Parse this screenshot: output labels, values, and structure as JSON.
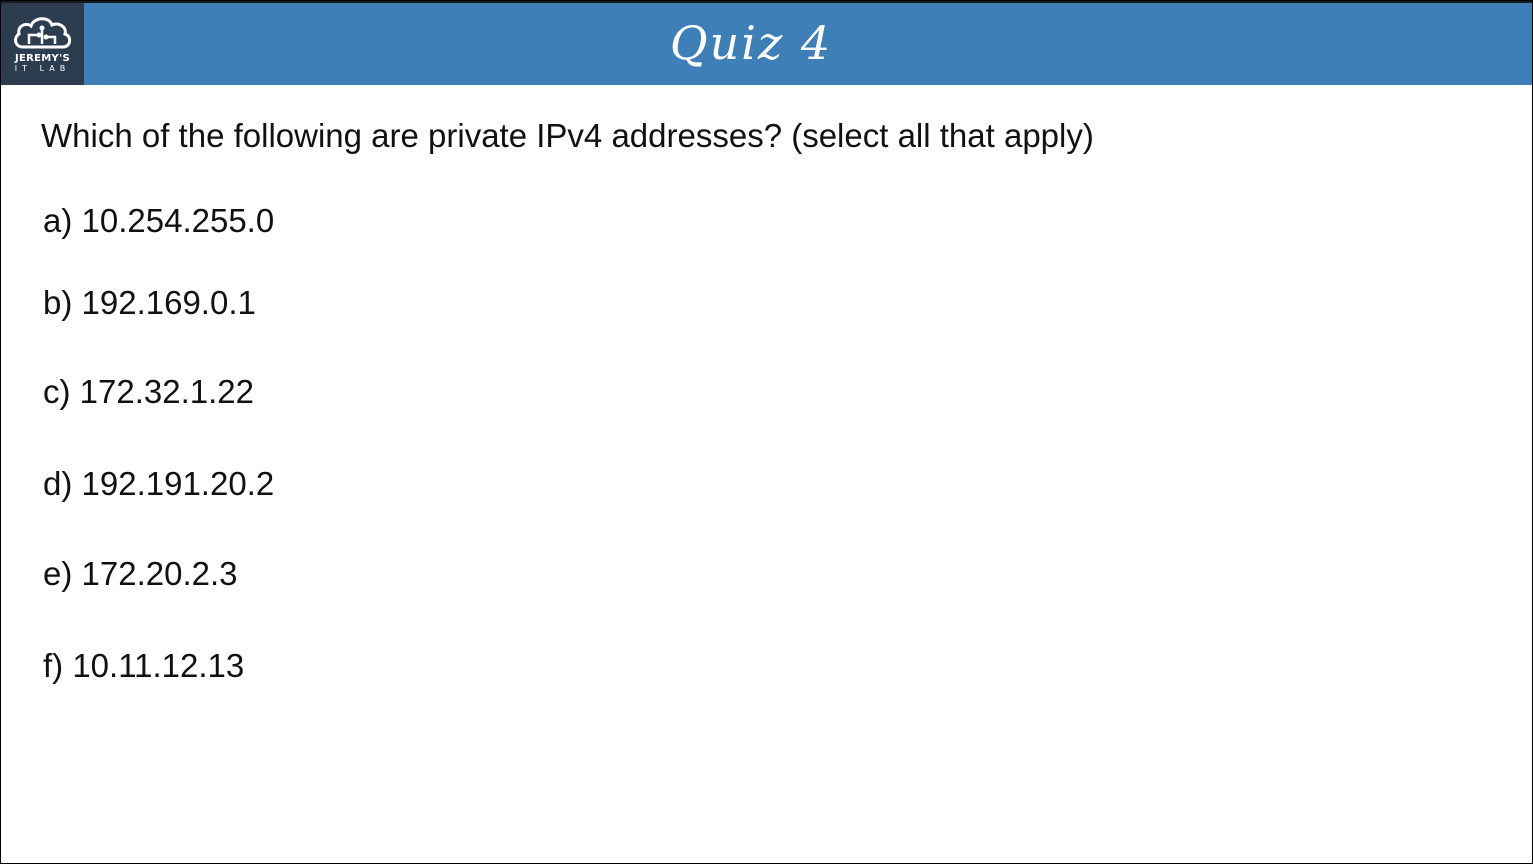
{
  "logo": {
    "line1": "JEREMY'S",
    "line2": "IT LAB"
  },
  "header": {
    "title": "Quiz 4"
  },
  "question": "Which of the following are private IPv4 addresses? (select all that apply)",
  "options": [
    "a) 10.254.255.0",
    "b) 192.169.0.1",
    "c) 172.32.1.22",
    "d) 192.191.20.2",
    "e) 172.20.2.3",
    "f) 10.11.12.13"
  ],
  "colors": {
    "header_bg": "#3f7fb8",
    "logo_bg": "#2c3d4f",
    "text": "#111111"
  },
  "icons": {
    "logo": "cloud-circuit-icon"
  }
}
